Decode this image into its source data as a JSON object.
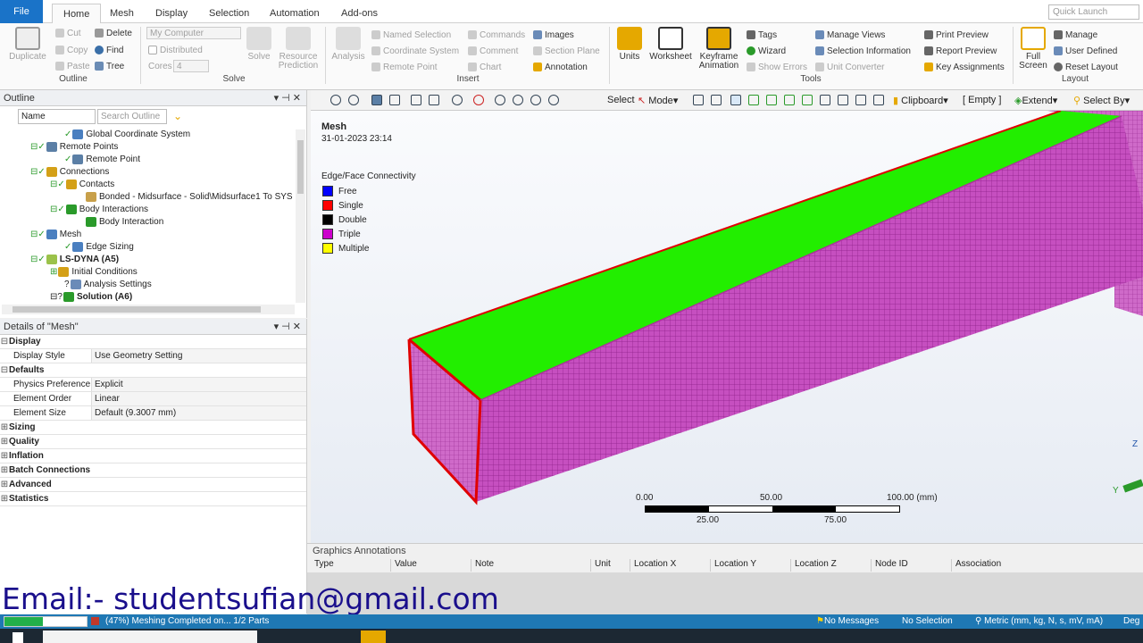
{
  "menubar": {
    "file": "File",
    "tabs": [
      "Home",
      "Mesh",
      "Display",
      "Selection",
      "Automation",
      "Add-ons"
    ],
    "active": "Home",
    "quick_launch_placeholder": "Quick Launch"
  },
  "ribbon": {
    "outline": {
      "group": "Outline",
      "duplicate": "Duplicate",
      "cut": "Cut",
      "copy": "Copy",
      "paste": "Paste",
      "delete": "Delete",
      "find": "Find",
      "tree": "Tree"
    },
    "solve": {
      "group": "Solve",
      "computer": "My Computer",
      "distributed": "Distributed",
      "cores_label": "Cores",
      "cores_value": "4",
      "solve": "Solve",
      "resource_prediction": "Resource Prediction"
    },
    "insert": {
      "group": "Insert",
      "analysis": "Analysis",
      "named_selection": "Named Selection",
      "coordinate_system": "Coordinate System",
      "remote_point": "Remote Point",
      "commands": "Commands",
      "comment": "Comment",
      "chart": "Chart",
      "images": "Images",
      "section_plane": "Section Plane",
      "annotation": "Annotation"
    },
    "tools": {
      "group": "Tools",
      "units": "Units",
      "worksheet": "Worksheet",
      "keyframe": "Keyframe Animation",
      "tags": "Tags",
      "wizard": "Wizard",
      "show_errors": "Show Errors",
      "manage_views": "Manage Views",
      "selection_information": "Selection Information",
      "unit_converter": "Unit Converter",
      "print_preview": "Print Preview",
      "report_preview": "Report Preview",
      "key_assignments": "Key Assignments"
    },
    "layout": {
      "group": "Layout",
      "full_screen": "Full Screen",
      "manage": "Manage",
      "user_defined": "User Defined",
      "reset_layout": "Reset Layout"
    }
  },
  "outline": {
    "title": "Outline",
    "name_label": "Name",
    "search_placeholder": "Search Outline",
    "items": [
      "Global Coordinate System",
      "Remote Points",
      "Remote Point",
      "Connections",
      "Contacts",
      "Bonded - Midsurface - Solid\\Midsurface1 To SYS",
      "Body Interactions",
      "Body Interaction",
      "Mesh",
      "Edge Sizing",
      "LS-DYNA (A5)",
      "Initial Conditions",
      "Analysis Settings",
      "Solution (A6)"
    ]
  },
  "details": {
    "title": "Details of \"Mesh\"",
    "display_section": "Display",
    "display_style_k": "Display Style",
    "display_style_v": "Use Geometry Setting",
    "defaults_section": "Defaults",
    "physics_k": "Physics Preference",
    "physics_v": "Explicit",
    "order_k": "Element Order",
    "order_v": "Linear",
    "size_k": "Element Size",
    "size_v": "Default (9.3007 mm)",
    "collapsed": [
      "Sizing",
      "Quality",
      "Inflation",
      "Batch Connections",
      "Advanced",
      "Statistics"
    ]
  },
  "toolbar": {
    "select": "Select",
    "mode": "Mode",
    "clipboard": "Clipboard",
    "empty": "[ Empty ]",
    "extend": "Extend",
    "select_by": "Select By"
  },
  "viewport": {
    "title": "Mesh",
    "date": "31-01-2023 23:14",
    "legend_title": "Edge/Face Connectivity",
    "legend": [
      {
        "label": "Free",
        "color": "#0000ff"
      },
      {
        "label": "Single",
        "color": "#ff0000"
      },
      {
        "label": "Double",
        "color": "#000000"
      },
      {
        "label": "Triple",
        "color": "#cc00cc"
      },
      {
        "label": "Multiple",
        "color": "#ffff00"
      }
    ],
    "scale_top": [
      "0.00",
      "50.00",
      "100.00 (mm)"
    ],
    "scale_bottom": [
      "25.00",
      "75.00"
    ]
  },
  "annotations": {
    "title": "Graphics Annotations",
    "columns": [
      "Type",
      "Value",
      "Note",
      "Unit",
      "Location X",
      "Location Y",
      "Location Z",
      "Node ID",
      "Association"
    ]
  },
  "status": {
    "progress_text": "(47%) Meshing Completed on... 1/2 Parts",
    "progress": 0.47,
    "messages": "No Messages",
    "selection": "No Selection",
    "units": "Metric (mm, kg, N, s, mV, mA)",
    "deg": "Deg"
  },
  "overlay": {
    "email": "Email:- studentsufian@gmail.com"
  }
}
